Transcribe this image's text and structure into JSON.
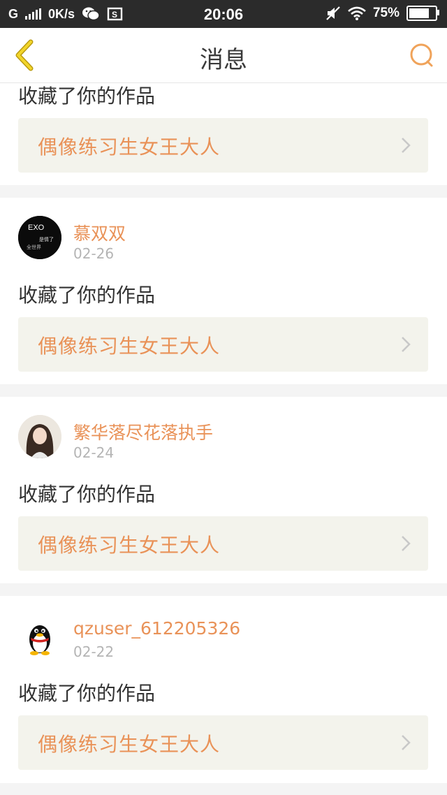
{
  "status": {
    "carrier": "G",
    "speed": "0K/s",
    "time": "20:06",
    "battery": "75%"
  },
  "nav": {
    "title": "消息"
  },
  "colors": {
    "accent": "#e99258",
    "card_bg": "#f3f3ec",
    "separator": "#f4f4f4"
  },
  "messages": [
    {
      "action": "收藏了你的作品",
      "work": "偶像练习生女王大人"
    },
    {
      "user": "慕双双",
      "date": "02-26",
      "avatar_text_line1": "EXO",
      "avatar_text_line2": "是情了",
      "avatar_text_line3": "全世界",
      "action": "收藏了你的作品",
      "work": "偶像练习生女王大人"
    },
    {
      "user": "繁华落尽花落执手",
      "date": "02-24",
      "action": "收藏了你的作品",
      "work": "偶像练习生女王大人"
    },
    {
      "user": "qzuser_612205326",
      "date": "02-22",
      "action": "收藏了你的作品",
      "work": "偶像练习生女王大人"
    }
  ]
}
